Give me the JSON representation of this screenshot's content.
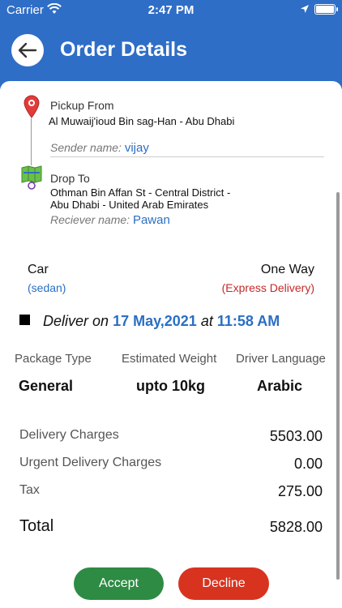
{
  "status": {
    "carrier": "Carrier",
    "time": "2:47 PM"
  },
  "header": {
    "title": "Order Details"
  },
  "pickup": {
    "label": "Pickup From",
    "address": "Al Muwaij'ioud Bin sag-Han - Abu Dhabi",
    "name_label": "Sender name:",
    "name": "vijay"
  },
  "dropoff": {
    "label": "Drop To",
    "address_line1": "Othman Bin Affan St - Central District -",
    "address_line2": "Abu Dhabi - United Arab Emirates",
    "name_label": "Reciever name:",
    "name": "Pawan"
  },
  "vehicle": {
    "type": "Car",
    "subtype": "(sedan)"
  },
  "trip": {
    "type": "One Way",
    "subtype": "(Express Delivery)"
  },
  "delivery": {
    "prefix": "Deliver on",
    "date": "17 May,2021",
    "at": "at",
    "time": "11:58 AM"
  },
  "details": {
    "headers": [
      "Package Type",
      "Estimated Weight",
      "Driver Language"
    ],
    "values": [
      "General",
      "upto 10kg",
      "Arabic"
    ]
  },
  "charges": [
    {
      "label": "Delivery Charges",
      "value": "5503.00"
    },
    {
      "label": "Urgent Delivery Charges",
      "value": "0.00"
    },
    {
      "label": "Tax",
      "value": "275.00"
    }
  ],
  "total": {
    "label": "Total",
    "value": "5828.00"
  },
  "actions": {
    "accept": "Accept",
    "decline": "Decline"
  },
  "colors": {
    "primary": "#2f6ec7",
    "accent_blue": "#2a6fc4",
    "accept": "#2e8b44",
    "decline": "#d8331f",
    "express_red": "#c62828"
  },
  "icons": {
    "back": "arrow-left-icon",
    "pickup": "location-pin-icon",
    "drop": "map-icon",
    "wifi": "wifi-icon",
    "location": "location-arrow-icon",
    "battery": "battery-icon"
  }
}
